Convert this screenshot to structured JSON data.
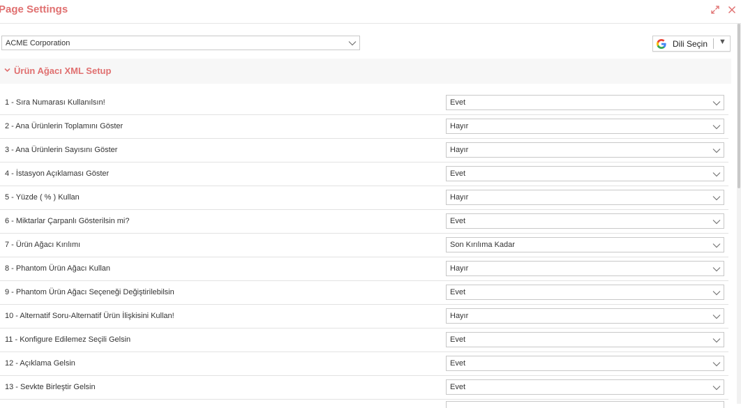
{
  "header": {
    "title": "Page Settings"
  },
  "company_select": {
    "value": "ACME Corporation"
  },
  "translate": {
    "label": "Dili Seçin",
    "arrow": "▼"
  },
  "section": {
    "title": "Ürün Ağacı XML Setup"
  },
  "settings": [
    {
      "label": "1 - Sıra Numarası Kullanılsın!",
      "value": "Evet"
    },
    {
      "label": "2 - Ana Ürünlerin Toplamını Göster",
      "value": "Hayır"
    },
    {
      "label": "3 - Ana Ürünlerin Sayısını Göster",
      "value": "Hayır"
    },
    {
      "label": "4 - İstasyon Açıklaması Göster",
      "value": "Evet"
    },
    {
      "label": "5 - Yüzde ( % ) Kullan",
      "value": "Hayır"
    },
    {
      "label": "6 - Miktarlar Çarpanlı Gösterilsin mi?",
      "value": "Evet"
    },
    {
      "label": "7 - Ürün Ağacı Kırılımı",
      "value": "Son Kırılıma Kadar"
    },
    {
      "label": "8 - Phantom Ürün Ağacı Kullan",
      "value": "Hayır"
    },
    {
      "label": "9 - Phantom Ürün Ağacı Seçeneği Değiştirilebilsin",
      "value": "Evet"
    },
    {
      "label": "10 - Alternatif Soru-Alternatif Ürün İlişkisini Kullan!",
      "value": "Hayır"
    },
    {
      "label": "11 - Konfigure Edilemez Seçili Gelsin",
      "value": "Evet"
    },
    {
      "label": "12 - Açıklama Gelsin",
      "value": "Evet"
    },
    {
      "label": "13 - Sevkte Birleştir Gelsin",
      "value": "Evet"
    }
  ],
  "colors": {
    "accent": "#e07070",
    "section_bg": "#f7f7f7",
    "border": "#c8c8c8"
  }
}
